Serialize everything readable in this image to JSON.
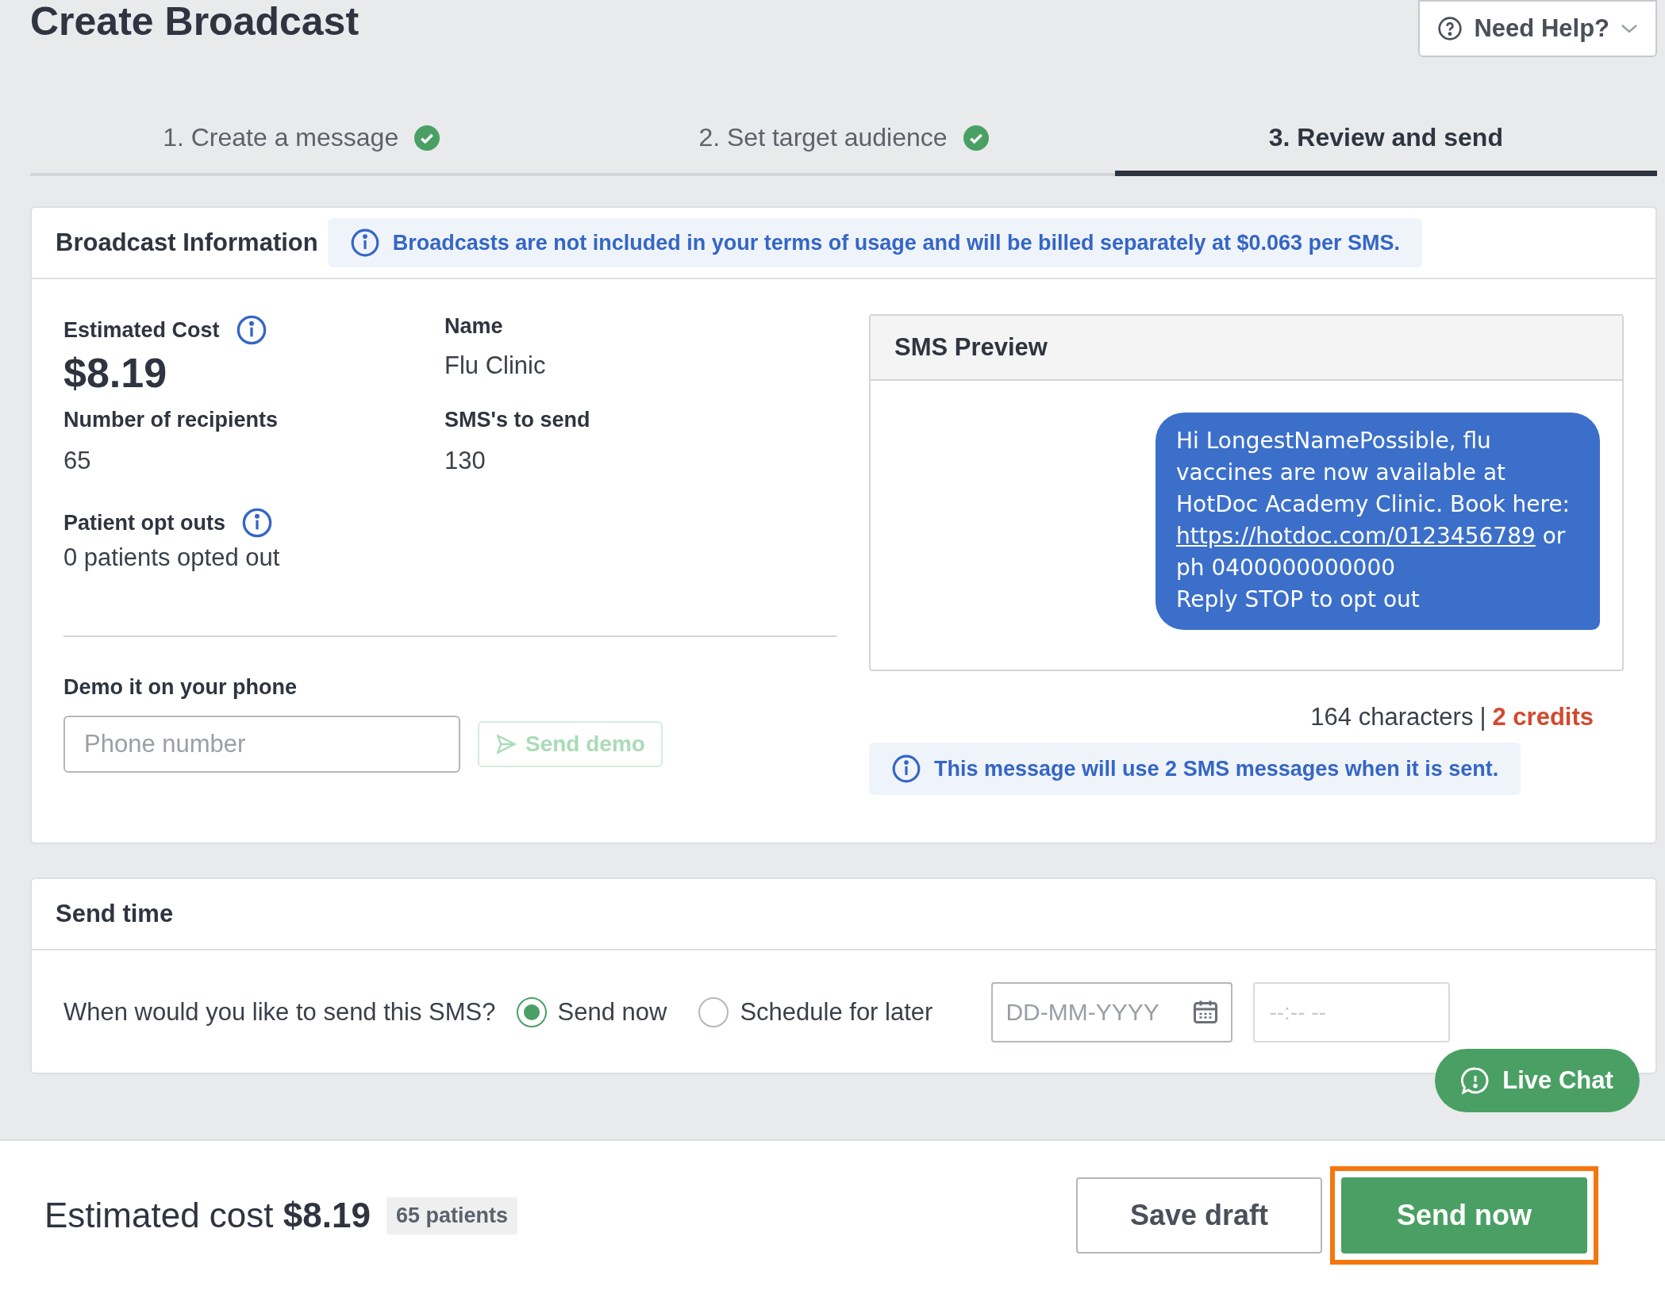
{
  "page": {
    "title": "Create Broadcast",
    "help_button": "Need Help?"
  },
  "steps": [
    {
      "label": "1. Create a message",
      "completed": true,
      "selected": false
    },
    {
      "label": "2. Set target audience",
      "completed": true,
      "selected": false
    },
    {
      "label": "3. Review and send",
      "completed": false,
      "selected": true
    }
  ],
  "broadcast_info": {
    "title": "Broadcast Information",
    "notice": "Broadcasts are not included in your terms of usage and will be billed separately at $0.063 per SMS.",
    "estimated_cost_label": "Estimated Cost",
    "estimated_cost": "$8.19",
    "name_label": "Name",
    "name": "Flu Clinic",
    "recipients_label": "Number of recipients",
    "recipients": "65",
    "sms_count_label": "SMS's to send",
    "sms_count": "130",
    "opt_outs_label": "Patient opt outs",
    "opt_outs": "0 patients opted out",
    "demo_label": "Demo it on your phone",
    "phone_placeholder": "Phone number",
    "send_demo": {
      "label": "Send demo",
      "disabled": true
    }
  },
  "sms_preview": {
    "title": "SMS Preview",
    "message": [
      {
        "kind": "text",
        "text": "Hi LongestNamePossible, flu vaccines are now available at HotDoc Academy Clinic. Book here: "
      },
      {
        "kind": "link",
        "text": "https://hotdoc.com/0123456789"
      },
      {
        "kind": "text",
        "text": " or ph 0400000000000"
      },
      {
        "kind": "line",
        "text": "Reply STOP to opt out"
      }
    ],
    "characters": "164 characters",
    "separator": "|",
    "credits": "2 credits",
    "notice": "This message will use 2 SMS messages when it is sent."
  },
  "send_time": {
    "title": "Send time",
    "question": "When would you like to send this SMS?",
    "options": [
      {
        "label": "Send now",
        "selected": true
      },
      {
        "label": "Schedule for later",
        "selected": false
      }
    ],
    "date_placeholder": "DD-MM-YYYY",
    "time_placeholder": "--:-- --"
  },
  "live_chat": "Live Chat",
  "footer": {
    "cost_label": "Estimated cost",
    "cost": "$8.19",
    "patients": "65 patients",
    "save_draft": "Save draft",
    "send_now": "Send now",
    "send_now_highlighted": true
  }
}
